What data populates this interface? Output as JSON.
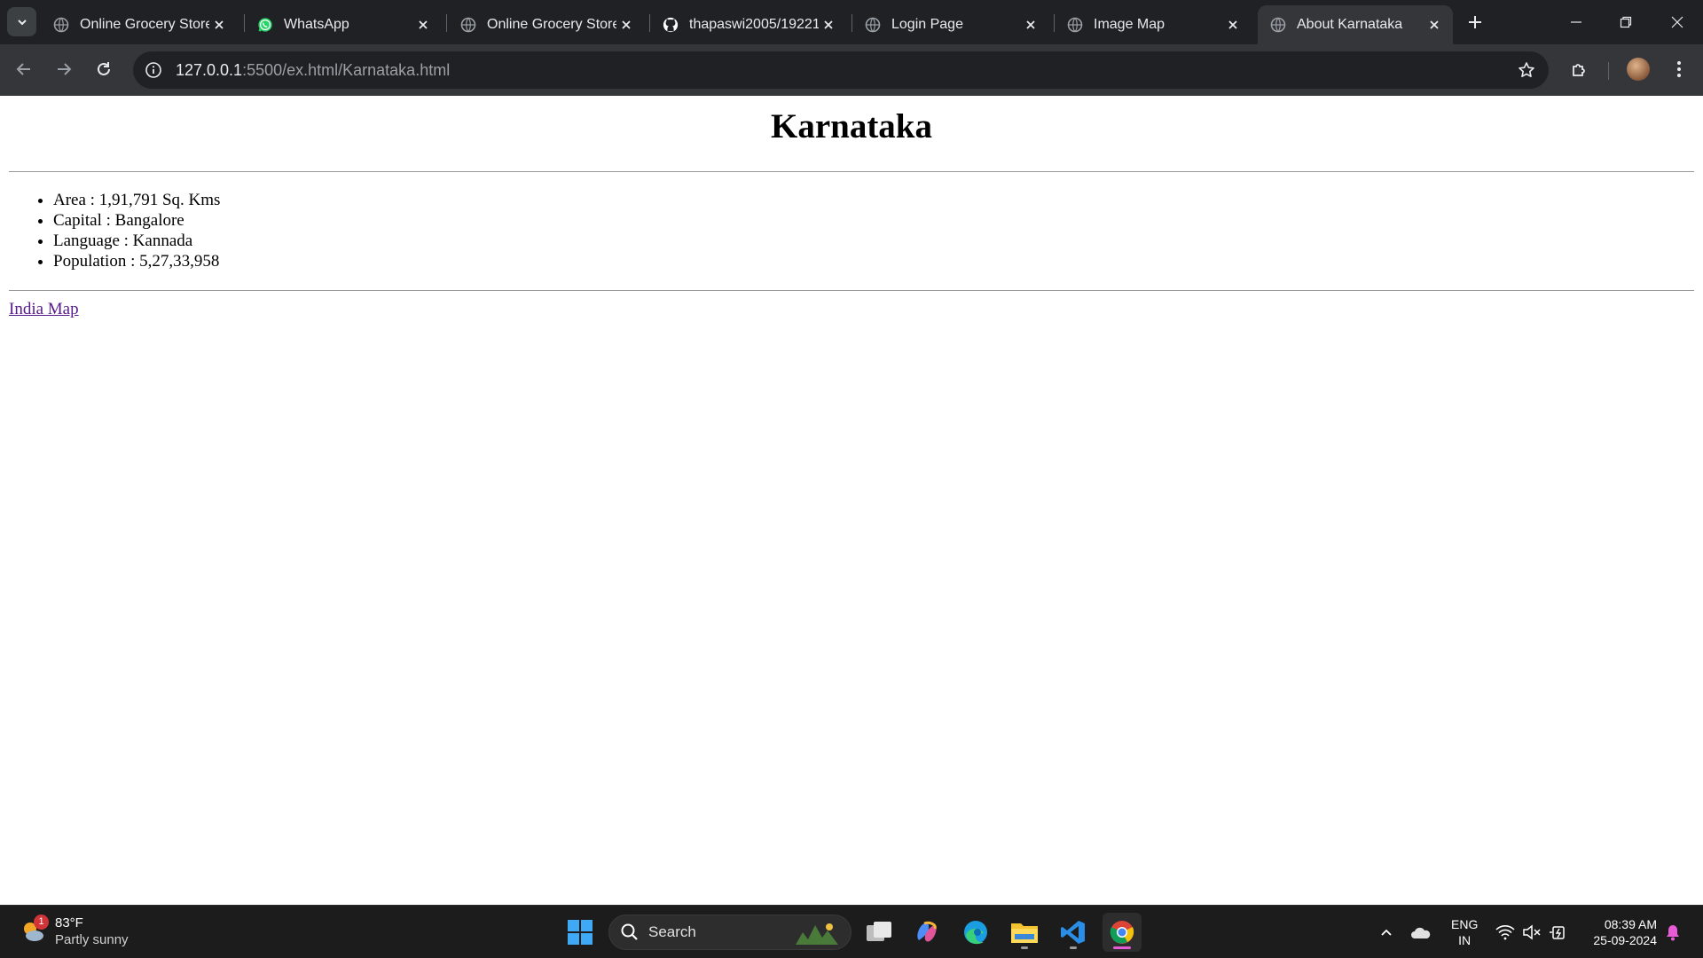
{
  "browser": {
    "tabs": [
      {
        "title": "Online Grocery Store",
        "icon": "globe-icon",
        "active": false
      },
      {
        "title": "WhatsApp",
        "icon": "whatsapp-icon",
        "active": false
      },
      {
        "title": "Online Grocery Store",
        "icon": "globe-icon",
        "active": false
      },
      {
        "title": "thapaswi2005/19221",
        "icon": "github-icon",
        "active": false
      },
      {
        "title": "Login Page",
        "icon": "globe-icon",
        "active": false
      },
      {
        "title": "Image Map",
        "icon": "globe-icon",
        "active": false
      },
      {
        "title": "About Karnataka",
        "icon": "globe-icon",
        "active": true
      }
    ],
    "url_host": "127.0.0.1",
    "url_rest": ":5500/ex.html/Karnataka.html"
  },
  "page": {
    "heading": "Karnataka",
    "facts": [
      "Area : 1,91,791 Sq. Kms",
      "Capital : Bangalore",
      "Language : Kannada",
      "Population : 5,27,33,958"
    ],
    "link_text": "India Map"
  },
  "taskbar": {
    "weather_temp": "83°F",
    "weather_condition": "Partly sunny",
    "weather_badge": "1",
    "search_label": "Search",
    "lang_line1": "ENG",
    "lang_line2": "IN",
    "time": "08:39 AM",
    "date": "25-09-2024"
  },
  "colors": {
    "tabstrip": "#202124",
    "toolbar": "#35363a",
    "link_visited": "#551a8b",
    "taskbar": "#1c1c1c"
  }
}
